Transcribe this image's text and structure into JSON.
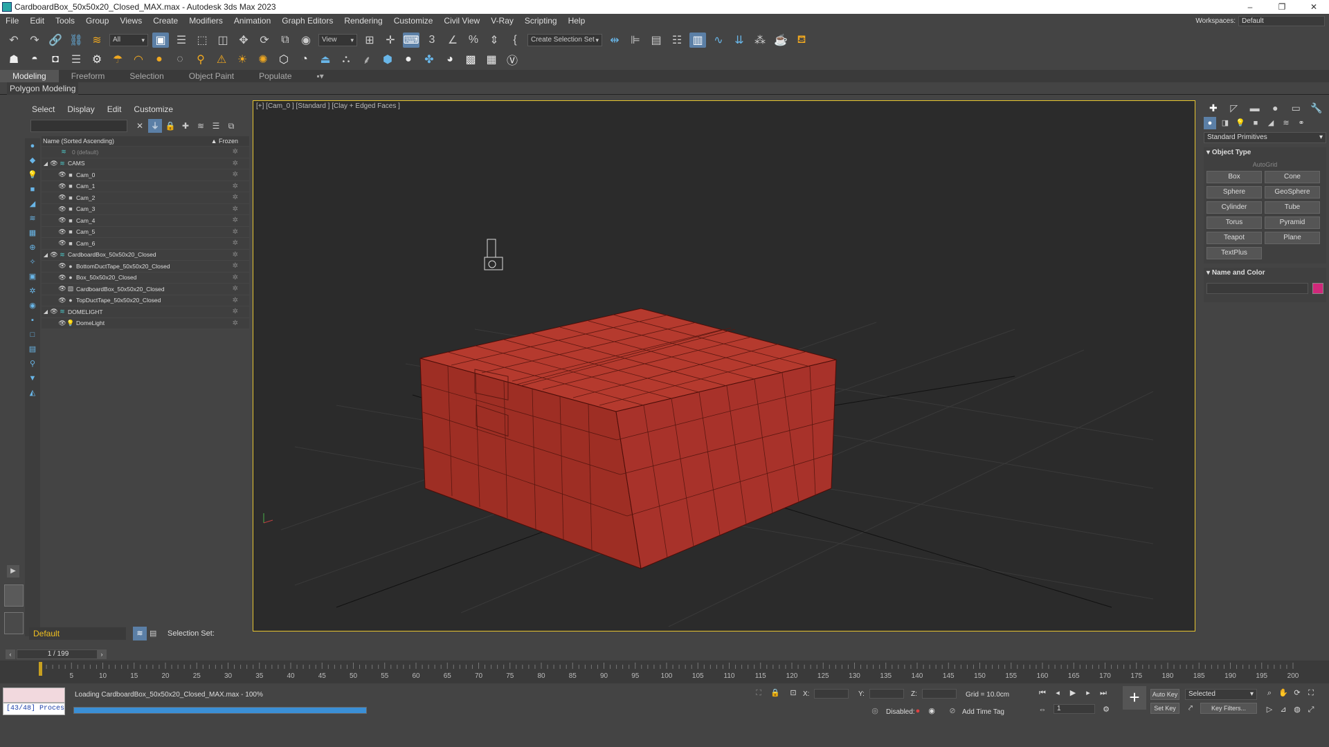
{
  "window": {
    "title": "CardboardBox_50x50x20_Closed_MAX.max - Autodesk 3ds Max 2023",
    "controls": [
      "–",
      "❐",
      "✕"
    ]
  },
  "menubar": {
    "items": [
      "File",
      "Edit",
      "Tools",
      "Group",
      "Views",
      "Create",
      "Modifiers",
      "Animation",
      "Graph Editors",
      "Rendering",
      "Customize",
      "Civil View",
      "V-Ray",
      "Scripting",
      "Help"
    ],
    "workspaces_label": "Workspaces:",
    "workspace": "Default"
  },
  "main_toolbar": {
    "filter_dropdown": "All",
    "ref_coord_dropdown": "View",
    "selection_set_dropdown": "Create Selection Set"
  },
  "ribbon": {
    "tabs": [
      "Modeling",
      "Freeform",
      "Selection",
      "Object Paint",
      "Populate"
    ],
    "active_tab": "Modeling",
    "panel_label": "Polygon Modeling"
  },
  "scene_explorer": {
    "menu": [
      "Select",
      "Display",
      "Edit",
      "Customize"
    ],
    "column_name": "Name (Sorted Ascending)",
    "column_frozen": "▲ Frozen",
    "rows": [
      {
        "name": "0 (default)",
        "level": 0,
        "type": "layer",
        "dim": true
      },
      {
        "name": "CAMS",
        "level": 0,
        "type": "layer",
        "expanded": true
      },
      {
        "name": "Cam_0",
        "level": 1,
        "type": "camera"
      },
      {
        "name": "Cam_1",
        "level": 1,
        "type": "camera"
      },
      {
        "name": "Cam_2",
        "level": 1,
        "type": "camera"
      },
      {
        "name": "Cam_3",
        "level": 1,
        "type": "camera"
      },
      {
        "name": "Cam_4",
        "level": 1,
        "type": "camera"
      },
      {
        "name": "Cam_5",
        "level": 1,
        "type": "camera"
      },
      {
        "name": "Cam_6",
        "level": 1,
        "type": "camera"
      },
      {
        "name": "CardboardBox_50x50x20_Closed",
        "level": 0,
        "type": "layer",
        "expanded": true
      },
      {
        "name": "BottomDuctTape_50x50x20_Closed",
        "level": 1,
        "type": "geometry"
      },
      {
        "name": "Box_50x50x20_Closed",
        "level": 1,
        "type": "geometry"
      },
      {
        "name": "CardboardBox_50x50x20_Closed",
        "level": 1,
        "type": "group"
      },
      {
        "name": "TopDuctTape_50x50x20_Closed",
        "level": 1,
        "type": "geometry"
      },
      {
        "name": "DOMELIGHT",
        "level": 0,
        "type": "layer",
        "expanded": true
      },
      {
        "name": "DomeLight",
        "level": 1,
        "type": "light"
      }
    ],
    "layer_dropdown": "Default",
    "selection_set_label": "Selection Set:"
  },
  "viewport": {
    "label": "[+] [Cam_0 ] [Standard ] [Clay + Edged Faces ]",
    "box_color": "#b23a2e",
    "border_color": "#e8c630"
  },
  "command_panel": {
    "category_dropdown": "Standard Primitives",
    "object_type_title": "Object Type",
    "autogrid": "AutoGrid",
    "buttons": [
      "Box",
      "Cone",
      "Sphere",
      "GeoSphere",
      "Cylinder",
      "Tube",
      "Torus",
      "Pyramid",
      "Teapot",
      "Plane",
      "TextPlus"
    ],
    "name_color_title": "Name and Color",
    "swatch_color": "#d0287a"
  },
  "timeline": {
    "frame_slider": "1 / 199",
    "ticks": [
      "5",
      "10",
      "15",
      "20",
      "25",
      "30",
      "35",
      "40",
      "45",
      "50",
      "55",
      "60",
      "65",
      "70",
      "75",
      "80",
      "85",
      "90",
      "95",
      "100",
      "105",
      "110",
      "115",
      "120",
      "125",
      "130",
      "135",
      "140",
      "145",
      "150",
      "155",
      "160",
      "165",
      "170",
      "175",
      "180",
      "185",
      "190",
      "195",
      "200"
    ]
  },
  "status_bar": {
    "maxscript_listener": "[43/48] Proces",
    "message": "Loading CardboardBox_50x50x20_Closed_MAX.max - 100%",
    "progress": 1.0,
    "x_label": "X:",
    "y_label": "Y:",
    "z_label": "Z:",
    "grid": "Grid = 10.0cm",
    "disabled_label": "Disabled:",
    "add_time_tag": "Add Time Tag",
    "current_frame": "1",
    "auto_key": "Auto Key",
    "set_key": "Set Key",
    "key_mode_dropdown": "Selected",
    "key_filters": "Key Filters..."
  }
}
